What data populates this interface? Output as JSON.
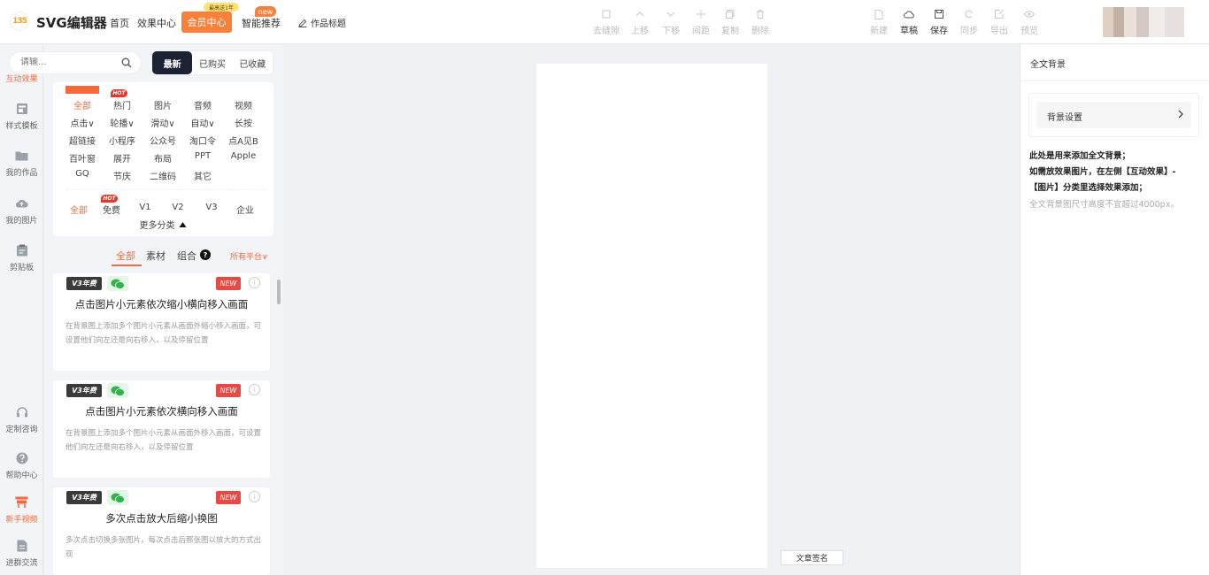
{
  "app": {
    "logo_mark": "135",
    "name": "SVG编辑器",
    "nav": [
      "首页",
      "效果中心"
    ],
    "vip_label": "会员中心",
    "vip_badge": "最高送1年",
    "recommend_label": "智能推荐",
    "recommend_badge": "new",
    "work_title": "作品标题"
  },
  "toolbar": {
    "edit_tools": [
      {
        "label": "去缝隙",
        "icon": "square-icon"
      },
      {
        "label": "上移",
        "icon": "chevron-up-icon"
      },
      {
        "label": "下移",
        "icon": "chevron-down-icon"
      },
      {
        "label": "间距",
        "icon": "spacing-icon"
      },
      {
        "label": "复制",
        "icon": "copy-icon"
      },
      {
        "label": "删除",
        "icon": "trash-icon"
      }
    ],
    "file_tools": [
      {
        "label": "新建",
        "icon": "file-icon",
        "active": false
      },
      {
        "label": "草稿",
        "icon": "cloud-icon",
        "active": true
      },
      {
        "label": "保存",
        "icon": "save-icon",
        "active": true
      },
      {
        "label": "同步",
        "icon": "sync-icon",
        "active": false
      },
      {
        "label": "导出",
        "icon": "export-icon",
        "active": false
      },
      {
        "label": "预览",
        "icon": "eye-icon",
        "active": false
      }
    ]
  },
  "rail": {
    "top": [
      {
        "label": "互动效果",
        "icon": "cube-icon",
        "active": true
      },
      {
        "label": "样式模板",
        "icon": "template-icon",
        "active": false
      },
      {
        "label": "我的作品",
        "icon": "folder-icon",
        "active": false
      },
      {
        "label": "我的图片",
        "icon": "cloud-upload-icon",
        "active": false
      },
      {
        "label": "剪贴板",
        "icon": "clipboard-icon",
        "active": false
      }
    ],
    "bottom": [
      {
        "label": "定制咨询",
        "icon": "headset-icon",
        "active": false
      },
      {
        "label": "帮助中心",
        "icon": "question-icon",
        "active": false
      },
      {
        "label": "新手视频",
        "icon": "video-icon",
        "active": true
      },
      {
        "label": "进群交流",
        "icon": "doc-icon",
        "active": false
      }
    ]
  },
  "library": {
    "search_placeholder": "请输...",
    "seg_tabs": [
      {
        "label": "最新",
        "active": true
      },
      {
        "label": "已购买",
        "active": false
      },
      {
        "label": "已收藏",
        "active": false
      }
    ],
    "hot_badge": "HOT",
    "categories": [
      {
        "label": "全部",
        "active": true
      },
      {
        "label": "热门"
      },
      {
        "label": "图片"
      },
      {
        "label": "音频"
      },
      {
        "label": "视频"
      },
      {
        "label": "点击∨"
      },
      {
        "label": "轮播∨"
      },
      {
        "label": "滑动∨"
      },
      {
        "label": "自动∨"
      },
      {
        "label": "长按"
      },
      {
        "label": "超链接"
      },
      {
        "label": "小程序"
      },
      {
        "label": "公众号"
      },
      {
        "label": "淘口令"
      },
      {
        "label": "点A见B"
      },
      {
        "label": "百叶窗"
      },
      {
        "label": "展开"
      },
      {
        "label": "布局"
      },
      {
        "label": "PPT"
      },
      {
        "label": "Apple"
      },
      {
        "label": "GQ"
      },
      {
        "label": "节庆"
      },
      {
        "label": "二维码"
      },
      {
        "label": "其它"
      }
    ],
    "versions": [
      {
        "label": "全部",
        "active": true
      },
      {
        "label": "免费"
      },
      {
        "label": "V1"
      },
      {
        "label": "V2"
      },
      {
        "label": "V3"
      },
      {
        "label": "企业"
      }
    ],
    "more_label": "更多分类",
    "sub_tabs": [
      {
        "label": "全部",
        "active": true
      },
      {
        "label": "素材"
      },
      {
        "label": "组合"
      }
    ],
    "help_mark": "?",
    "platform_label": "所有平台∨",
    "cards": [
      {
        "tag": "V3年费",
        "new": "NEW",
        "title": "点击图片小元素依次缩小横向移入画面",
        "desc": "在背景图上添加多个图片小元素从画面外缩小移入画面，可设置他们向左还是向右移入，以及停留位置"
      },
      {
        "tag": "V3年费",
        "new": "NEW",
        "title": "点击图片小元素依次横向移入画面",
        "desc": "在背景图上添加多个图片小元素从画面外移入画面，可设置他们向左还是向右移入，以及停留位置"
      },
      {
        "tag": "V3年费",
        "new": "NEW",
        "title": "多次点击放大后缩小换图",
        "desc": "多次点击切换多张图片，每次点击后那张图以放大的方式出现"
      }
    ]
  },
  "canvas": {
    "sign_label": "文章签名"
  },
  "right": {
    "title": "全文背景",
    "bg_setting_label": "背景设置",
    "hint1": "此处是用来添加全文背景；",
    "hint2": "如需放效果图片，在左侧【互动效果】-",
    "hint3": "【图片】分类里选择效果添加；",
    "hint4": "全文背景图尺寸高度不宜超过4000px。"
  },
  "colors": {
    "accent": "#f5693c",
    "vip": "#f7803b",
    "dark_tab": "#1b2233",
    "hot": "#e03a2c"
  }
}
